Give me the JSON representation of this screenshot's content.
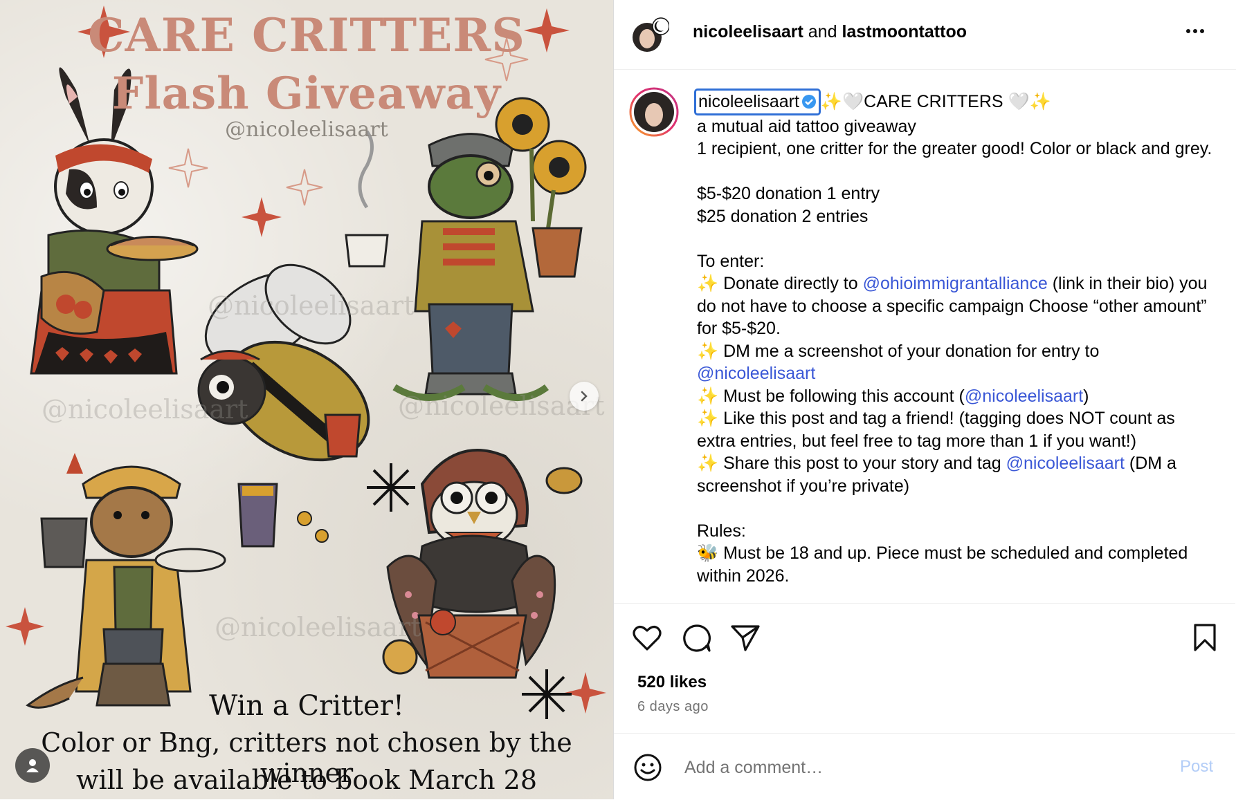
{
  "poster": {
    "title_line1": "CARE CRITTERS",
    "title_line2": "Flash Giveaway",
    "handle": "@nicoleelisaart",
    "watermark": "@nicoleelisaart",
    "caption_line1": "Win a Critter!",
    "caption_line2": "Color or Bng, critters not chosen by the winner",
    "caption_line3": "will be available to book March 28",
    "next_icon": "chevron-right-icon",
    "user_tag_icon": "user-icon"
  },
  "header": {
    "user1": "nicoleelisaart",
    "joiner": "and",
    "user2": "lastmoontattoo",
    "more_icon": "more-horizontal-icon"
  },
  "caption": {
    "username": "nicoleelisaart",
    "title": "✨🤍CARE CRITTERS 🤍✨",
    "lines": {
      "l1": "a mutual aid tattoo giveaway",
      "l2": "1 recipient, one critter for the greater good! Color or black and grey.",
      "l3": "$5-$20 donation 1 entry",
      "l4": "$25 donation 2 entries",
      "l5": "To enter:",
      "l6a": "✨ Donate directly to ",
      "l6link": "@ohioimmigrantalliance",
      "l6b": " (link in their bio) you do not have to choose a specific campaign Choose “other amount” for $5-$20.",
      "l7a": "✨ DM me a screenshot of your donation for entry to ",
      "l7link": "@nicoleelisaart",
      "l8a": "✨ Must be following this account (",
      "l8link": "@nicoleelisaart",
      "l8b": ")",
      "l9": "✨ Like this post and tag a friend! (tagging does NOT count as extra entries, but feel free to tag more than 1 if you want!)",
      "l10a": "✨ Share this post to your story and tag ",
      "l10link": "@nicoleelisaart",
      "l10b": " (DM a screenshot if you’re private)",
      "l11": "Rules:",
      "l12": "🐝 Must be 18 and up. Piece must be scheduled and completed within 2026."
    }
  },
  "actions": {
    "like_icon": "heart-icon",
    "comment_icon": "comment-icon",
    "share_icon": "send-icon",
    "save_icon": "bookmark-icon",
    "likes": "520 likes",
    "time": "6 days ago"
  },
  "comment": {
    "emoji_icon": "emoji-icon",
    "placeholder": "Add a comment…",
    "post_label": "Post"
  },
  "colors": {
    "link": "#3a57d6",
    "verified": "#3897f0",
    "title_salmon": "#c98a78",
    "post_disabled": "#b3cdf7"
  }
}
